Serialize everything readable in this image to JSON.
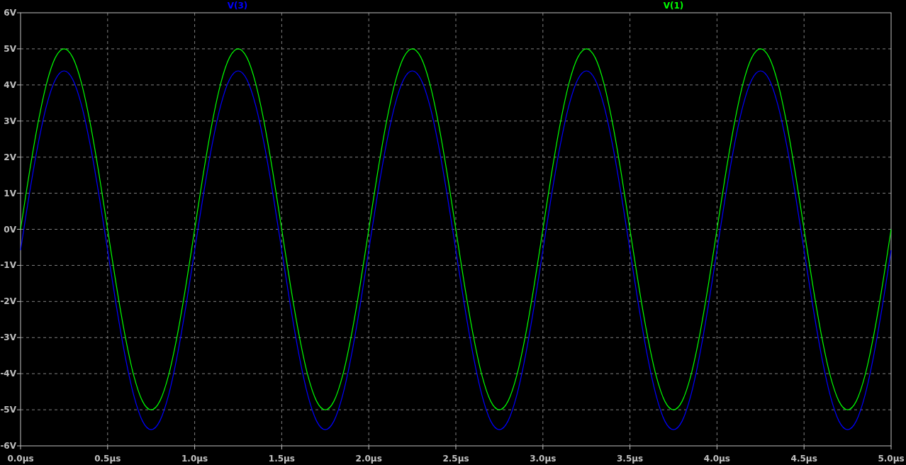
{
  "chart_data": {
    "type": "line",
    "grid": true,
    "xlim": [
      0,
      5
    ],
    "ylim": [
      -6,
      6
    ],
    "xticks": [
      {
        "value": 0,
        "label": "0.0µs"
      },
      {
        "value": 0.5,
        "label": "0.5µs"
      },
      {
        "value": 1,
        "label": "1.0µs"
      },
      {
        "value": 1.5,
        "label": "1.5µs"
      },
      {
        "value": 2,
        "label": "2.0µs"
      },
      {
        "value": 2.5,
        "label": "2.5µs"
      },
      {
        "value": 3,
        "label": "3.0µs"
      },
      {
        "value": 3.5,
        "label": "3.5µs"
      },
      {
        "value": 4,
        "label": "4.0µs"
      },
      {
        "value": 4.5,
        "label": "4.5µs"
      },
      {
        "value": 5,
        "label": "5.0µs"
      }
    ],
    "yticks": [
      {
        "value": 6,
        "label": "6V"
      },
      {
        "value": 5,
        "label": "5V"
      },
      {
        "value": 4,
        "label": "4V"
      },
      {
        "value": 3,
        "label": "3V"
      },
      {
        "value": 2,
        "label": "2V"
      },
      {
        "value": 1,
        "label": "1V"
      },
      {
        "value": 0,
        "label": "0V"
      },
      {
        "value": -1,
        "label": "-1V"
      },
      {
        "value": -2,
        "label": "-2V"
      },
      {
        "value": -3,
        "label": "-3V"
      },
      {
        "value": -4,
        "label": "-4V"
      },
      {
        "value": -5,
        "label": "-5V"
      },
      {
        "value": -6,
        "label": "-6V"
      }
    ],
    "x": [
      0,
      0.05,
      0.1,
      0.15,
      0.2,
      0.25,
      0.3,
      0.35,
      0.4,
      0.45,
      0.5,
      0.55,
      0.6,
      0.65,
      0.7,
      0.75,
      0.8,
      0.85,
      0.9,
      0.95,
      1,
      1.05,
      1.1,
      1.15,
      1.2,
      1.25,
      1.3,
      1.35,
      1.4,
      1.45,
      1.5,
      1.55,
      1.6,
      1.65,
      1.7,
      1.75,
      1.8,
      1.85,
      1.9,
      1.95,
      2,
      2.05,
      2.1,
      2.15,
      2.2,
      2.25,
      2.3,
      2.35,
      2.4,
      2.45,
      2.5,
      2.55,
      2.6,
      2.65,
      2.7,
      2.75,
      2.8,
      2.85,
      2.9,
      2.95,
      3,
      3.05,
      3.1,
      3.15,
      3.2,
      3.25,
      3.3,
      3.35,
      3.4,
      3.45,
      3.5,
      3.55,
      3.6,
      3.65,
      3.7,
      3.75,
      3.8,
      3.85,
      3.9,
      3.95,
      4,
      4.05,
      4.1,
      4.15,
      4.2,
      4.25,
      4.3,
      4.35,
      4.4,
      4.45,
      4.5,
      4.55,
      4.6,
      4.65,
      4.7,
      4.75,
      4.8,
      4.85,
      4.9,
      4.95,
      5
    ],
    "series": [
      {
        "name": "V(3)",
        "color": "#0000ff",
        "values": [
          -0.58,
          0.96,
          2.34,
          3.44,
          4.15,
          4.39,
          4.15,
          3.44,
          2.34,
          0.96,
          -0.58,
          -2.12,
          -3.5,
          -4.6,
          -5.31,
          -5.55,
          -5.31,
          -4.6,
          -3.5,
          -2.12,
          -0.58,
          0.96,
          2.34,
          3.44,
          4.15,
          4.39,
          4.15,
          3.44,
          2.34,
          0.96,
          -0.58,
          -2.12,
          -3.5,
          -4.6,
          -5.31,
          -5.55,
          -5.31,
          -4.6,
          -3.5,
          -2.12,
          -0.58,
          0.96,
          2.34,
          3.44,
          4.15,
          4.39,
          4.15,
          3.44,
          2.34,
          0.96,
          -0.58,
          -2.12,
          -3.5,
          -4.6,
          -5.31,
          -5.55,
          -5.31,
          -4.6,
          -3.5,
          -2.12,
          -0.58,
          0.96,
          2.34,
          3.44,
          4.15,
          4.39,
          4.15,
          3.44,
          2.34,
          0.96,
          -0.58,
          -2.12,
          -3.5,
          -4.6,
          -5.31,
          -5.55,
          -5.31,
          -4.6,
          -3.5,
          -2.12,
          -0.58,
          0.96,
          2.34,
          3.44,
          4.15,
          4.39,
          4.15,
          3.44,
          2.34,
          0.96,
          -0.58,
          -2.12,
          -3.5,
          -4.6,
          -5.31,
          -5.55,
          -5.31,
          -4.6,
          -3.5,
          -2.12,
          -0.58
        ]
      },
      {
        "name": "V(1)",
        "color": "#00ff00",
        "values": [
          0,
          1.55,
          2.94,
          4.05,
          4.76,
          5,
          4.76,
          4.05,
          2.94,
          1.55,
          0,
          -1.55,
          -2.94,
          -4.05,
          -4.76,
          -5,
          -4.76,
          -4.05,
          -2.94,
          -1.55,
          0,
          1.55,
          2.94,
          4.05,
          4.76,
          5,
          4.76,
          4.05,
          2.94,
          1.55,
          0,
          -1.55,
          -2.94,
          -4.05,
          -4.76,
          -5,
          -4.76,
          -4.05,
          -2.94,
          -1.55,
          0,
          1.55,
          2.94,
          4.05,
          4.76,
          5,
          4.76,
          4.05,
          2.94,
          1.55,
          0,
          -1.55,
          -2.94,
          -4.05,
          -4.76,
          -5,
          -4.76,
          -4.05,
          -2.94,
          -1.55,
          0,
          1.55,
          2.94,
          4.05,
          4.76,
          5,
          4.76,
          4.05,
          2.94,
          1.55,
          0,
          -1.55,
          -2.94,
          -4.05,
          -4.76,
          -5,
          -4.76,
          -4.05,
          -2.94,
          -1.55,
          0,
          1.55,
          2.94,
          4.05,
          4.76,
          5,
          4.76,
          4.05,
          2.94,
          1.55,
          0,
          -1.55,
          -2.94,
          -4.05,
          -4.76,
          -5,
          -4.76,
          -4.05,
          -2.94,
          -1.55,
          0
        ]
      }
    ]
  }
}
